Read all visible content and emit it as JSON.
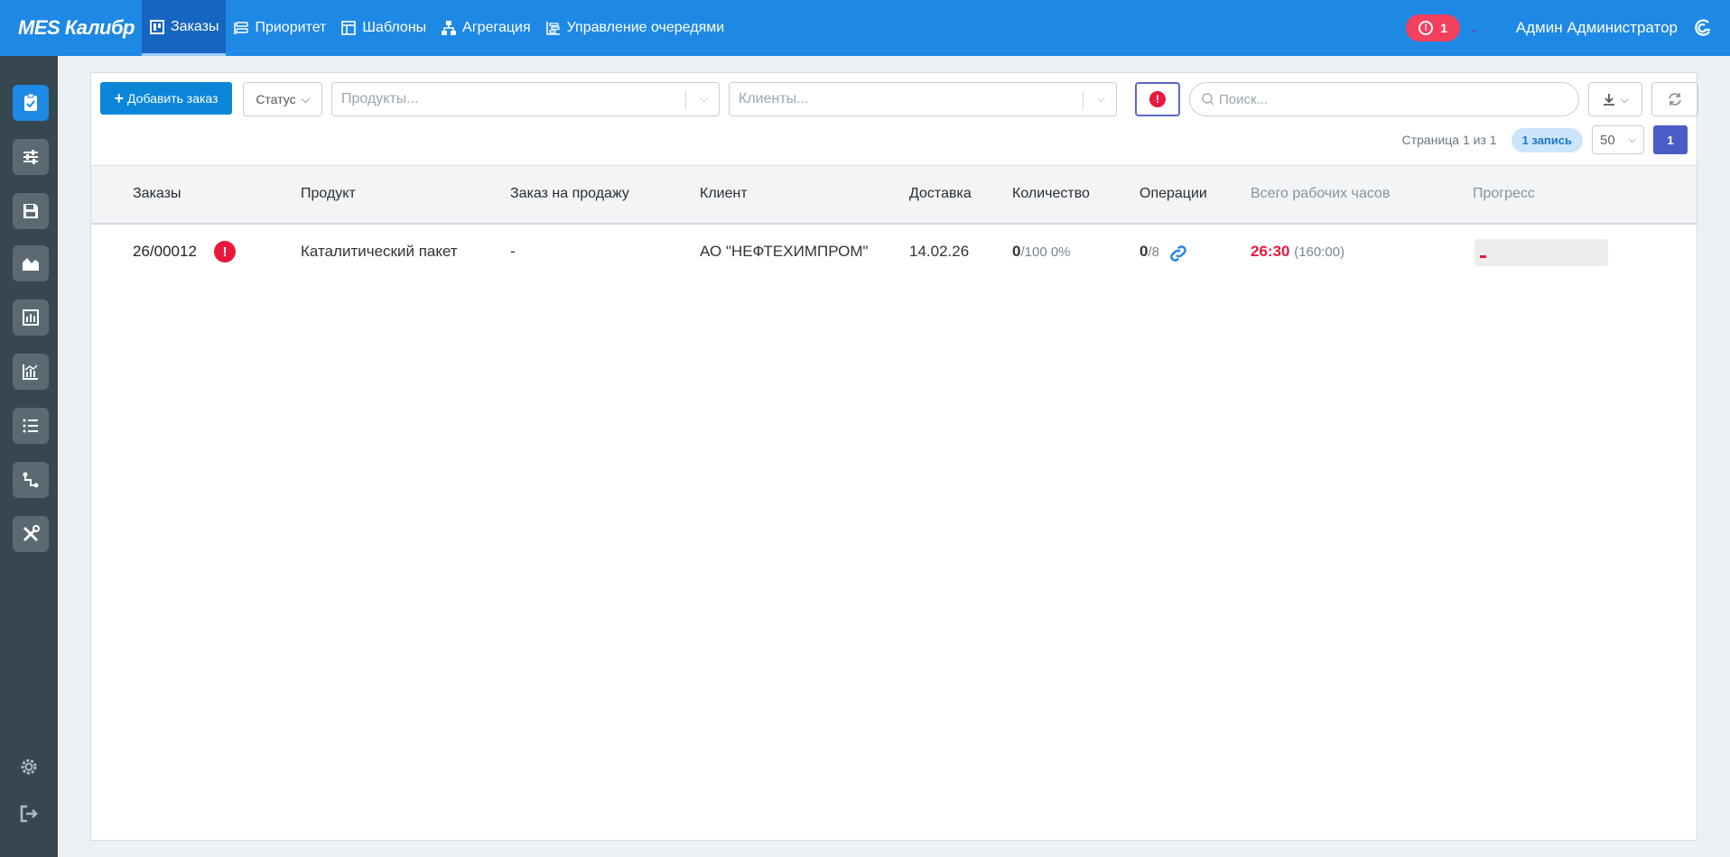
{
  "app": {
    "brand": "MES Калибр"
  },
  "nav": {
    "orders": "Заказы",
    "priority": "Приоритет",
    "templates": "Шаблоны",
    "aggregation": "Агрегация",
    "queues": "Управление очередями"
  },
  "header": {
    "alerts_count": "1",
    "alerts_icon": "!",
    "user_name": "Админ Администратор"
  },
  "sidebar": {
    "items": [
      "orders-icon",
      "sliders-icon",
      "save-icon",
      "area-chart-icon",
      "bar-chart-icon",
      "line-chart-icon",
      "list-icon",
      "route-icon",
      "tools-icon"
    ],
    "bottom": [
      "gear-icon",
      "logout-icon"
    ]
  },
  "toolbar": {
    "add_order_label": "Добавить заказ",
    "status_label": "Статус",
    "products_placeholder": "Продукты...",
    "clients_placeholder": "Клиенты...",
    "alert_filter_symbol": "!",
    "search_placeholder": "Поиск..."
  },
  "pager": {
    "page_text": "Страница 1 из 1",
    "records_badge": "1 запись",
    "per_page": "50",
    "current_page": "1"
  },
  "table": {
    "columns": {
      "orders": "Заказы",
      "product": "Продукт",
      "sales_order": "Заказ на продажу",
      "client": "Клиент",
      "delivery": "Доставка",
      "quantity": "Количество",
      "operations": "Операции",
      "total_hours": "Всего рабочих часов",
      "progress": "Прогресс"
    },
    "rows": [
      {
        "order": "26/00012",
        "alert_symbol": "!",
        "product": "Каталитический пакет",
        "sales_order": "-",
        "client": "АО \"НЕФТЕХИМПРОМ\"",
        "delivery": "14.02.26",
        "qty_done": "0",
        "qty_total": "/100 0%",
        "ops_done": "0",
        "ops_total": "/8",
        "hours_actual": "26:30",
        "hours_planned": "(160:00)",
        "progress_fraction": 0.0
      }
    ]
  },
  "colors": {
    "topbar": "#1e88e5",
    "sidebar": "#37474f",
    "accent_red": "#e8183e",
    "pager_active": "#4a5cc7"
  }
}
